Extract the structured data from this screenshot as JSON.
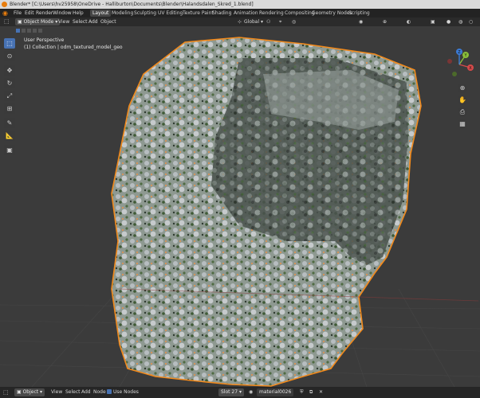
{
  "window": {
    "title": "Blender* [C:\\Users\\hv25958\\OneDrive - Halliburton\\Documents\\Blender\\Halandsdalen_Skred_1.blend]"
  },
  "menu": {
    "items": [
      "File",
      "Edit",
      "Render",
      "Window",
      "Help"
    ]
  },
  "workspaces": {
    "tabs": [
      "Layout",
      "Modeling",
      "Sculpting",
      "UV Editing",
      "Texture Paint",
      "Shading",
      "Animation",
      "Rendering",
      "Compositing",
      "Geometry Nodes",
      "Scripting"
    ],
    "active": "Layout"
  },
  "header": {
    "mode": "Object Mode",
    "items": [
      "View",
      "Select",
      "Add",
      "Object"
    ],
    "transform_orientation": "Global"
  },
  "viewport": {
    "perspective_label": "User Perspective",
    "collection_label": "(1) Collection | odm_textured_model_geo"
  },
  "gizmo": {
    "x": "X",
    "y": "Y",
    "z": "Z"
  },
  "statusbar": {
    "mode": "Object",
    "items": [
      "View",
      "Select",
      "Add",
      "Node"
    ],
    "use_nodes": "Use Nodes",
    "slot": "Slot 27",
    "material": "material0026"
  },
  "colors": {
    "accent": "#4772b3",
    "selection_outline": "#f28a1c",
    "title_bar": "#d9d9d9"
  }
}
